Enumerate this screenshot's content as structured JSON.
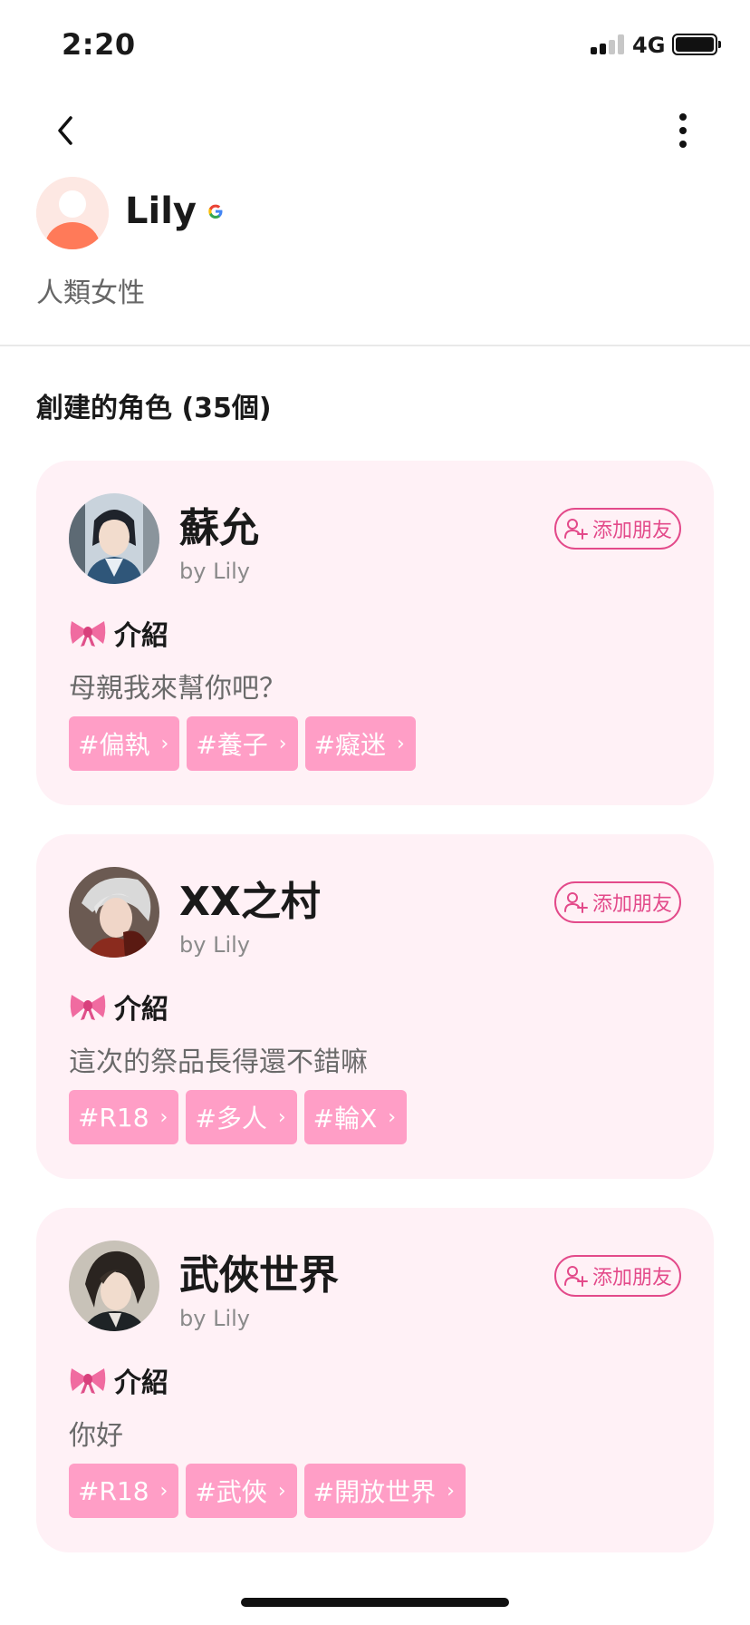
{
  "status_bar": {
    "time": "2:20",
    "network": "4G"
  },
  "profile": {
    "name": "Lily",
    "description": "人類女性"
  },
  "section": {
    "title": "創建的角色 (35個)"
  },
  "cards": [
    {
      "title": "蘇允",
      "by": "by Lily",
      "add_friend": "添加朋友",
      "intro_label": "介紹",
      "intro_text": "母親我來幫你吧？",
      "tags": [
        "#偏執",
        "#養子",
        "#癡迷"
      ]
    },
    {
      "title": "XX之村",
      "by": "by Lily",
      "add_friend": "添加朋友",
      "intro_label": "介紹",
      "intro_text": "這次的祭品長得還不錯嘛",
      "tags": [
        "#R18",
        "#多人",
        "#輪X"
      ]
    },
    {
      "title": "武俠世界",
      "by": "by Lily",
      "add_friend": "添加朋友",
      "intro_label": "介紹",
      "intro_text": "你好",
      "tags": [
        "#R18",
        "#武俠",
        "#開放世界"
      ]
    }
  ],
  "colors": {
    "accent": "#e34a8a",
    "tag_bg": "#ff9ec6",
    "card_bg": "#fff1f6"
  },
  "icons": {
    "back": "chevron-left-icon",
    "more": "more-vertical-icon",
    "bow": "ribbon-bow-icon",
    "add_friend": "add-user-icon",
    "verified": "google-icon"
  }
}
